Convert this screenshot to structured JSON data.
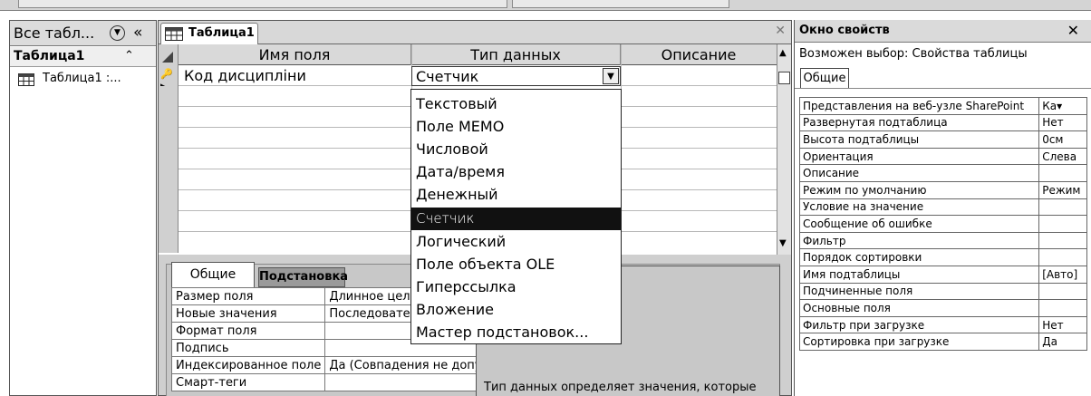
{
  "nav": {
    "title": "Все табл...",
    "group_label": "Таблица1",
    "item_label": "Таблица1 :..."
  },
  "document": {
    "tab_label": "Таблица1",
    "close_glyph": "✕",
    "headers": [
      "Имя поля",
      "Тип данных",
      "Описание"
    ],
    "rows": [
      {
        "name": "Код дисципліни",
        "type": "Счетчик",
        "description": ""
      }
    ]
  },
  "dropdown": {
    "options": [
      "Текстовый",
      "Поле MEMO",
      "Числовой",
      "Дата/время",
      "Денежный",
      "Счетчик",
      "Логический",
      "Поле объекта OLE",
      "Гиперссылка",
      "Вложение",
      "Мастер подстановок..."
    ],
    "selected": "Счетчик"
  },
  "field_properties": {
    "tab_general": "Общие",
    "tab_lookup": "Подстановка",
    "rows": [
      {
        "name": "Размер поля",
        "value": "Длинное целое"
      },
      {
        "name": "Новые значения",
        "value": "Последовательные"
      },
      {
        "name": "Формат поля",
        "value": ""
      },
      {
        "name": "Подпись",
        "value": ""
      },
      {
        "name": "Индексированное поле",
        "value": "Да (Совпадения не допускаются)"
      },
      {
        "name": "Смарт-теги",
        "value": ""
      }
    ],
    "help_text": "Тип данных определяет значения, которые"
  },
  "property_sheet": {
    "title": "Окно свойств",
    "close_glyph": "✕",
    "selection_type": "Возможен выбор:  Свойства таблицы",
    "tab": "Общие",
    "rows": [
      {
        "name": "Представления на веб-узле SharePoint",
        "value": "Ка▾"
      },
      {
        "name": "Развернутая подтаблица",
        "value": "Нет"
      },
      {
        "name": "Высота подтаблицы",
        "value": "0см"
      },
      {
        "name": "Ориентация",
        "value": "Слева"
      },
      {
        "name": "Описание",
        "value": ""
      },
      {
        "name": "Режим по умолчанию",
        "value": "Режим"
      },
      {
        "name": "Условие на значение",
        "value": ""
      },
      {
        "name": "Сообщение об ошибке",
        "value": ""
      },
      {
        "name": "Фильтр",
        "value": ""
      },
      {
        "name": "Порядок сортировки",
        "value": ""
      },
      {
        "name": "Имя подтаблицы",
        "value": "[Авто]"
      },
      {
        "name": "Подчиненные поля",
        "value": ""
      },
      {
        "name": "Основные поля",
        "value": ""
      },
      {
        "name": "Фильтр при загрузке",
        "value": "Нет"
      },
      {
        "name": "Сортировка при загрузке",
        "value": "Да"
      }
    ]
  }
}
